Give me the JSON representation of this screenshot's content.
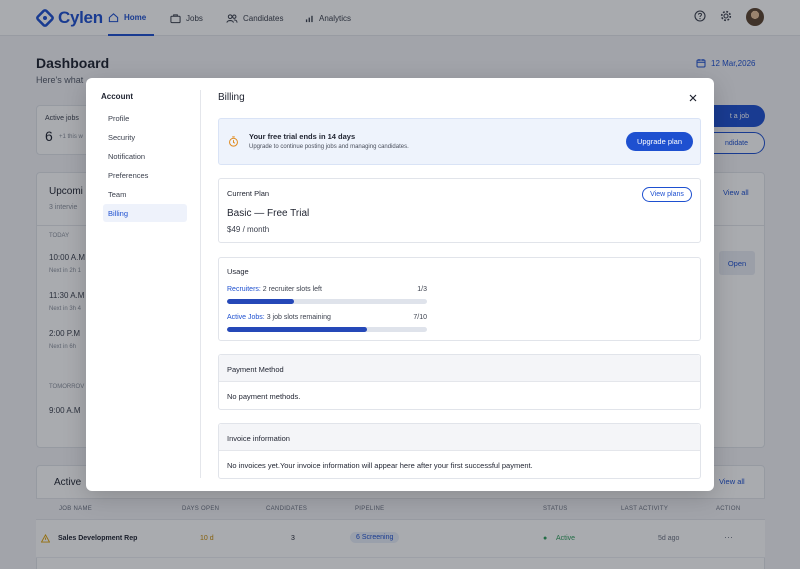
{
  "app": {
    "brand": "Cylen",
    "nav": [
      {
        "label": "Home",
        "icon": "home-icon",
        "active": true
      },
      {
        "label": "Jobs",
        "icon": "briefcase-icon",
        "active": false
      },
      {
        "label": "Candidates",
        "icon": "people-icon",
        "active": false
      },
      {
        "label": "Analytics",
        "icon": "chart-icon",
        "active": false
      }
    ],
    "header_icons": [
      "help-icon",
      "gear-icon",
      "avatar"
    ]
  },
  "dashboard": {
    "title": "Dashboard",
    "subtitle": "Here's what",
    "date": "12 Mar,2026",
    "active_jobs_label": "Active jobs",
    "active_jobs_value": "6",
    "active_jobs_delta": "+1 this w",
    "post_job_label": "t a job",
    "add_candidate_label": "ndidate",
    "upcoming": {
      "title": "Upcomi",
      "subtitle": "3 intervie",
      "view_all": "View all",
      "today_label": "TODAY",
      "tomorrow_label": "TOMORROV",
      "items": [
        {
          "time": "10:00 A.M",
          "note": "Next in 2h 1"
        },
        {
          "time": "11:30 A.M",
          "note": "Next in 3h 4"
        },
        {
          "time": "2:00  P.M",
          "note": "Next in 6h"
        }
      ],
      "tomorrow_items": [
        {
          "time": "9:00  A.M"
        }
      ],
      "open_label": "Open"
    },
    "active_jobs_table": {
      "title": "Active",
      "view_all": "View all",
      "columns": [
        "JOB NAME",
        "DAYS OPEN",
        "CANDIDATES",
        "PIPELINE",
        "STATUS",
        "LAST ACTIVITY",
        "ACTION"
      ],
      "rows": [
        {
          "job": "Sales Development Rep",
          "days": "10 d",
          "candidates": "3",
          "pipeline": "6  Screening",
          "status": "Active",
          "last_activity": "5d ago",
          "action": "···"
        }
      ]
    }
  },
  "modal": {
    "sidebar_title": "Account",
    "sidebar_items": [
      {
        "label": "Profile",
        "active": false
      },
      {
        "label": "Security",
        "active": false
      },
      {
        "label": "Notification",
        "active": false
      },
      {
        "label": "Preferences",
        "active": false
      },
      {
        "label": "Team",
        "active": false
      },
      {
        "label": "Billing",
        "active": true
      }
    ],
    "title": "Billing",
    "trial": {
      "title": "Your free trial ends in 14 days",
      "description": "Upgrade to continue posting jobs and managing candidates.",
      "button": "Upgrade plan"
    },
    "current_plan": {
      "label": "Current Plan",
      "name": "Basic — Free Trial",
      "price": "$49 / month",
      "button": "View plans"
    },
    "usage": {
      "label": "Usage",
      "items": [
        {
          "key": "Recruiters:",
          "value": "2 recruiter slots left",
          "count": "1/3",
          "fraction": 0.3333
        },
        {
          "key": "Active Jobs:",
          "value": "3 job slots remaining",
          "count": "7/10",
          "fraction": 0.7
        }
      ]
    },
    "payment": {
      "label": "Payment Method",
      "body": "No payment methods."
    },
    "invoice": {
      "label": "Invoice information",
      "body": "No invoices yet.Your invoice information will appear here after your first successful payment."
    }
  },
  "colors": {
    "accent": "#1e50d0",
    "bar_fill": "#2548b8",
    "trial_bg": "#eef3fc",
    "status_active": "#2e9e5b",
    "warning": "#e0a100"
  }
}
